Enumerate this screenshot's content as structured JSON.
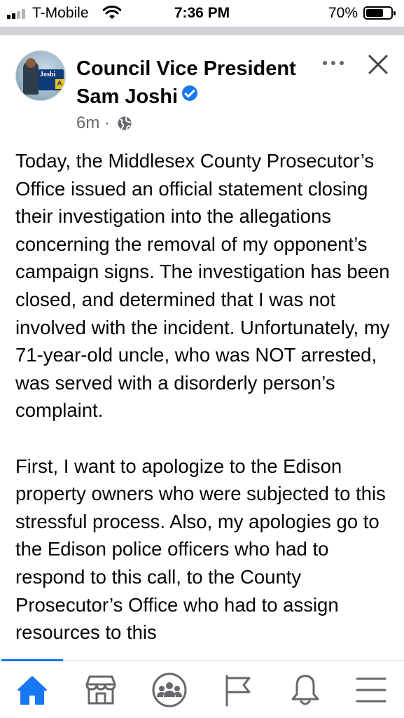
{
  "status_bar": {
    "carrier": "T-Mobile",
    "time": "7:36 PM",
    "battery_percent": "70%",
    "battery_level": 0.7,
    "signal_bars_filled": 2,
    "signal_bars_total": 4
  },
  "post": {
    "author_line1": "Council Vice President",
    "author_line2": "Sam Joshi",
    "verified": true,
    "time_ago": "6m",
    "separator": "·",
    "visibility_icon": "globe-icon",
    "avatar": {
      "sign_text": "Joshi",
      "sign_letter": "A"
    },
    "paragraphs": [
      "Today, the Middlesex County Prosecutor’s Office issued an official statement closing their investigation into the allegations concerning the removal of my opponent’s campaign signs.  The investigation has been closed, and determined that I was not involved with the incident. Unfortunately, my 71-year-old uncle, who was NOT arrested, was served with a disorderly person’s complaint.",
      "First, I want to apologize to the Edison property owners who were subjected to this stressful process.  Also, my apologies go to the Edison police officers who had to respond to this call, to the County Prosecutor’s Office who had to assign resources to this"
    ]
  },
  "header_actions": {
    "more_icon": "more-horizontal-icon",
    "close_icon": "close-icon"
  },
  "tab_bar": {
    "active_tab": "home",
    "tabs": [
      {
        "id": "home",
        "icon": "home-icon"
      },
      {
        "id": "marketplace",
        "icon": "storefront-icon"
      },
      {
        "id": "groups",
        "icon": "groups-icon"
      },
      {
        "id": "pages",
        "icon": "flag-icon"
      },
      {
        "id": "notifications",
        "icon": "bell-icon"
      },
      {
        "id": "menu",
        "icon": "menu-icon"
      }
    ]
  },
  "colors": {
    "accent": "#1877f2",
    "secondary_text": "#65676b",
    "icon_grey": "#65676b"
  }
}
